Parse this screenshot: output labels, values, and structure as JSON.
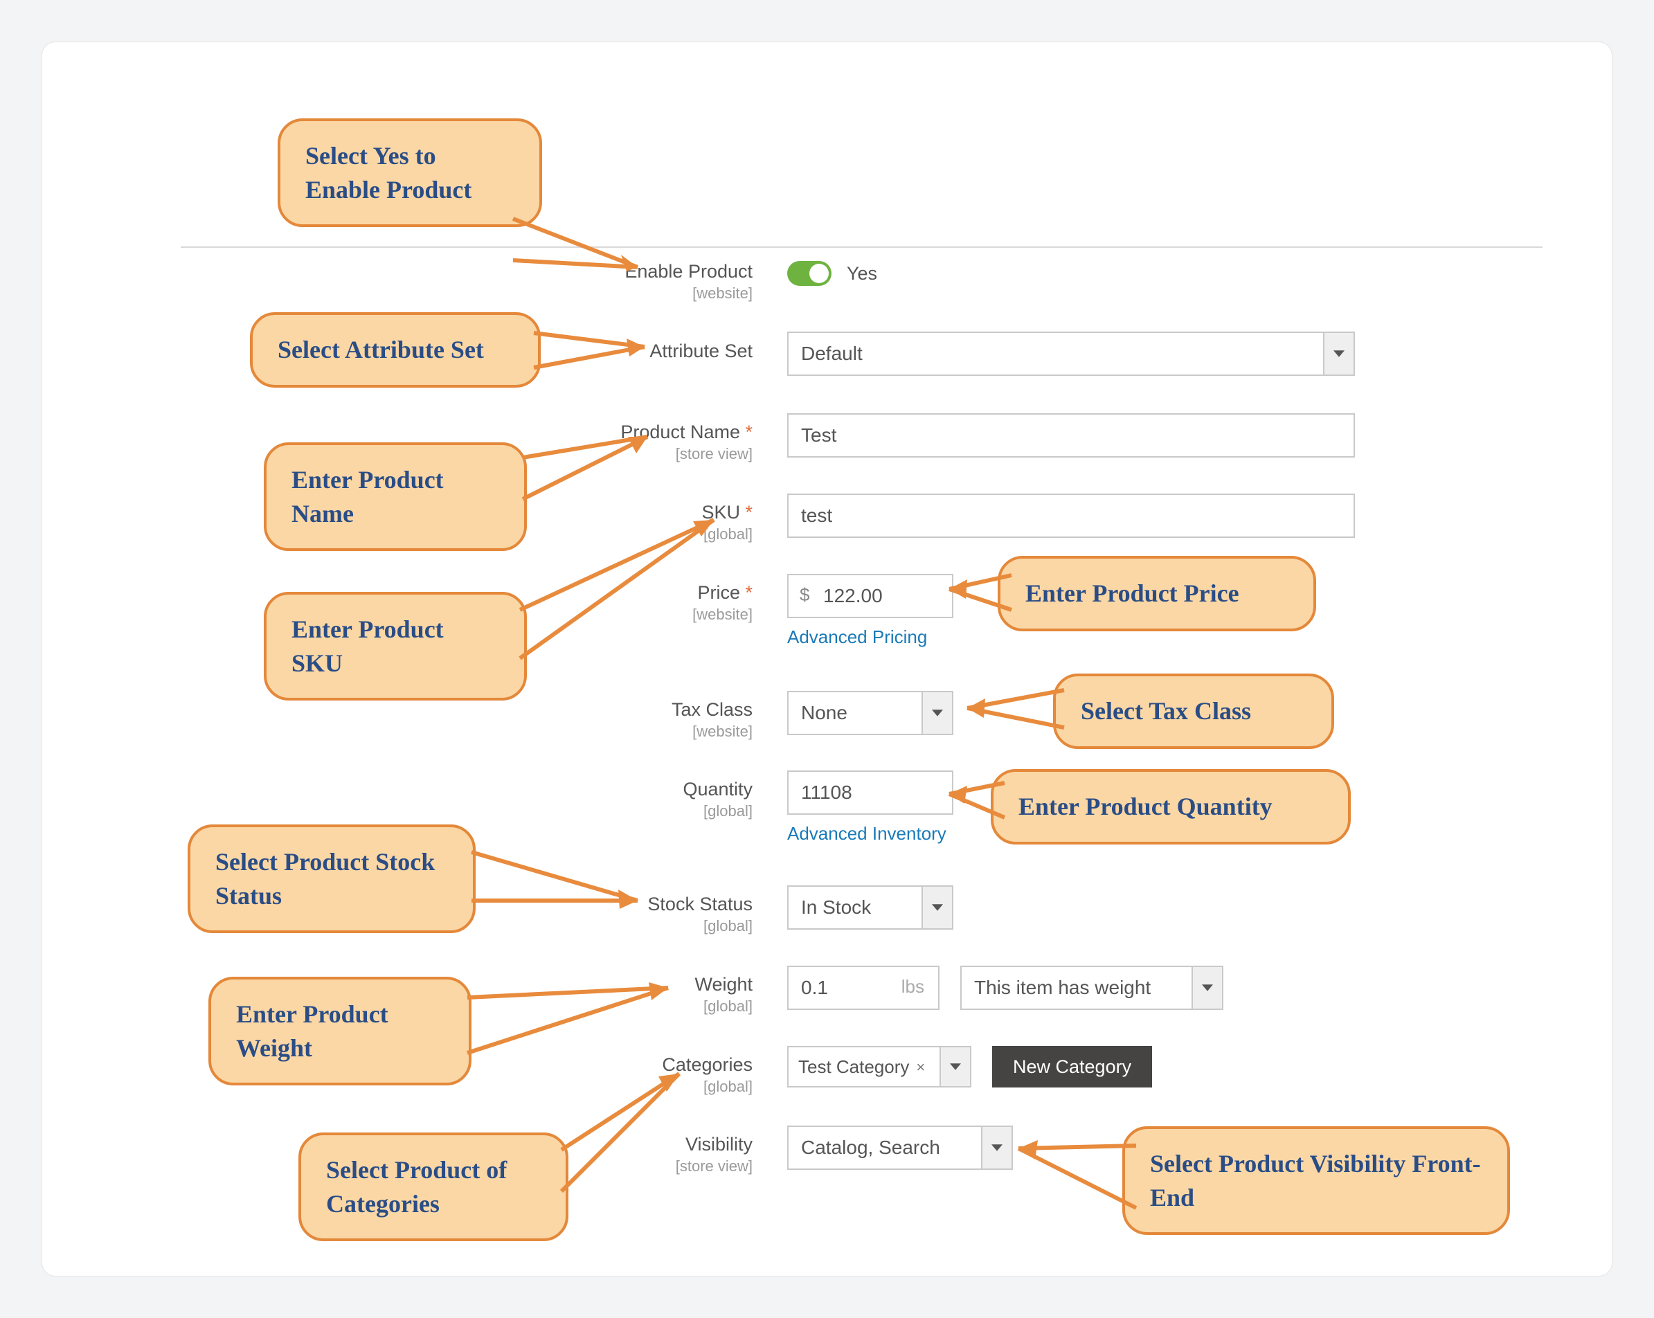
{
  "annotations": {
    "enable": "Select Yes to Enable Product",
    "attr_set": "Select Attribute Set",
    "name": "Enter Product Name",
    "sku": "Enter Product SKU",
    "price": "Enter Product Price",
    "tax": "Select Tax Class",
    "qty": "Enter Product Quantity",
    "stock": "Select Product Stock Status",
    "weight": "Enter Product Weight",
    "categories": "Select Product of Categories",
    "visibility": "Select Product Visibility Front-End"
  },
  "labels": {
    "enable": "Enable Product",
    "attr_set": "Attribute Set",
    "name": "Product Name",
    "sku": "SKU",
    "price": "Price",
    "tax": "Tax Class",
    "qty": "Quantity",
    "stock": "Stock Status",
    "weight": "Weight",
    "categories": "Categories",
    "visibility": "Visibility"
  },
  "scopes": {
    "website": "[website]",
    "store_view": "[store view]",
    "global": "[global]"
  },
  "values": {
    "enable_text": "Yes",
    "attr_set": "Default",
    "name": "Test",
    "sku": "test",
    "price_symbol": "$",
    "price": "122.00",
    "tax": "None",
    "qty": "11108",
    "stock": "In Stock",
    "weight": "0.1",
    "weight_unit": "lbs",
    "weight_mode": "This item has weight",
    "category_chip": "Test Category",
    "visibility": "Catalog, Search"
  },
  "links": {
    "adv_pricing": "Advanced Pricing",
    "adv_inventory": "Advanced Inventory"
  },
  "buttons": {
    "new_category": "New Category"
  },
  "chip_close": "×"
}
